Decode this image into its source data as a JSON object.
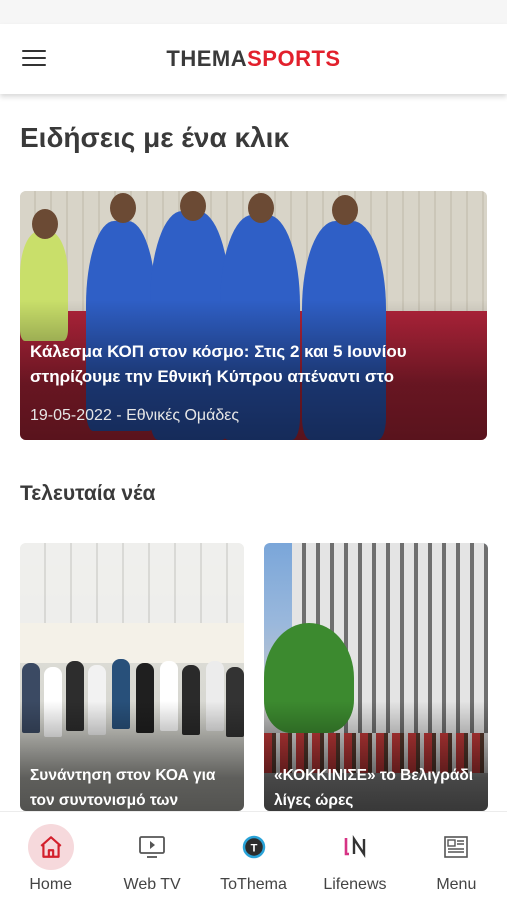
{
  "header": {
    "logo_part1": "THEMA",
    "logo_part2": "SPORTS"
  },
  "sections": {
    "featured_title": "Ειδήσεις με ένα κλικ",
    "latest_title": "Τελευταία νέα"
  },
  "hero": {
    "caption": "Κάλεσμα ΚΟΠ στον κόσμο: Στις 2 και 5 Ιουνίου στηρίζουμε την Εθνική Κύπρου απέναντι στο",
    "meta": "19-05-2022 - Εθνικές Ομάδες"
  },
  "latest": [
    {
      "caption": "Συνάντηση στον ΚΟΑ για τον συντονισμό των"
    },
    {
      "caption": "«ΚΟΚΚΙΝΙΣΕ» το Βελιγράδι λίγες ώρες"
    }
  ],
  "tabs": [
    {
      "label": "Home",
      "icon": "home-icon",
      "active": true
    },
    {
      "label": "Web TV",
      "icon": "tv-play-icon"
    },
    {
      "label": "ToThema",
      "icon": "tothema-icon"
    },
    {
      "label": "Lifenews",
      "icon": "lifenews-icon"
    },
    {
      "label": "Menu",
      "icon": "menu-grid-icon"
    }
  ],
  "colors": {
    "brand_red": "#e2202c",
    "logo_dark": "#3a3a3a",
    "active_tab_bg": "#f6d9dc"
  }
}
